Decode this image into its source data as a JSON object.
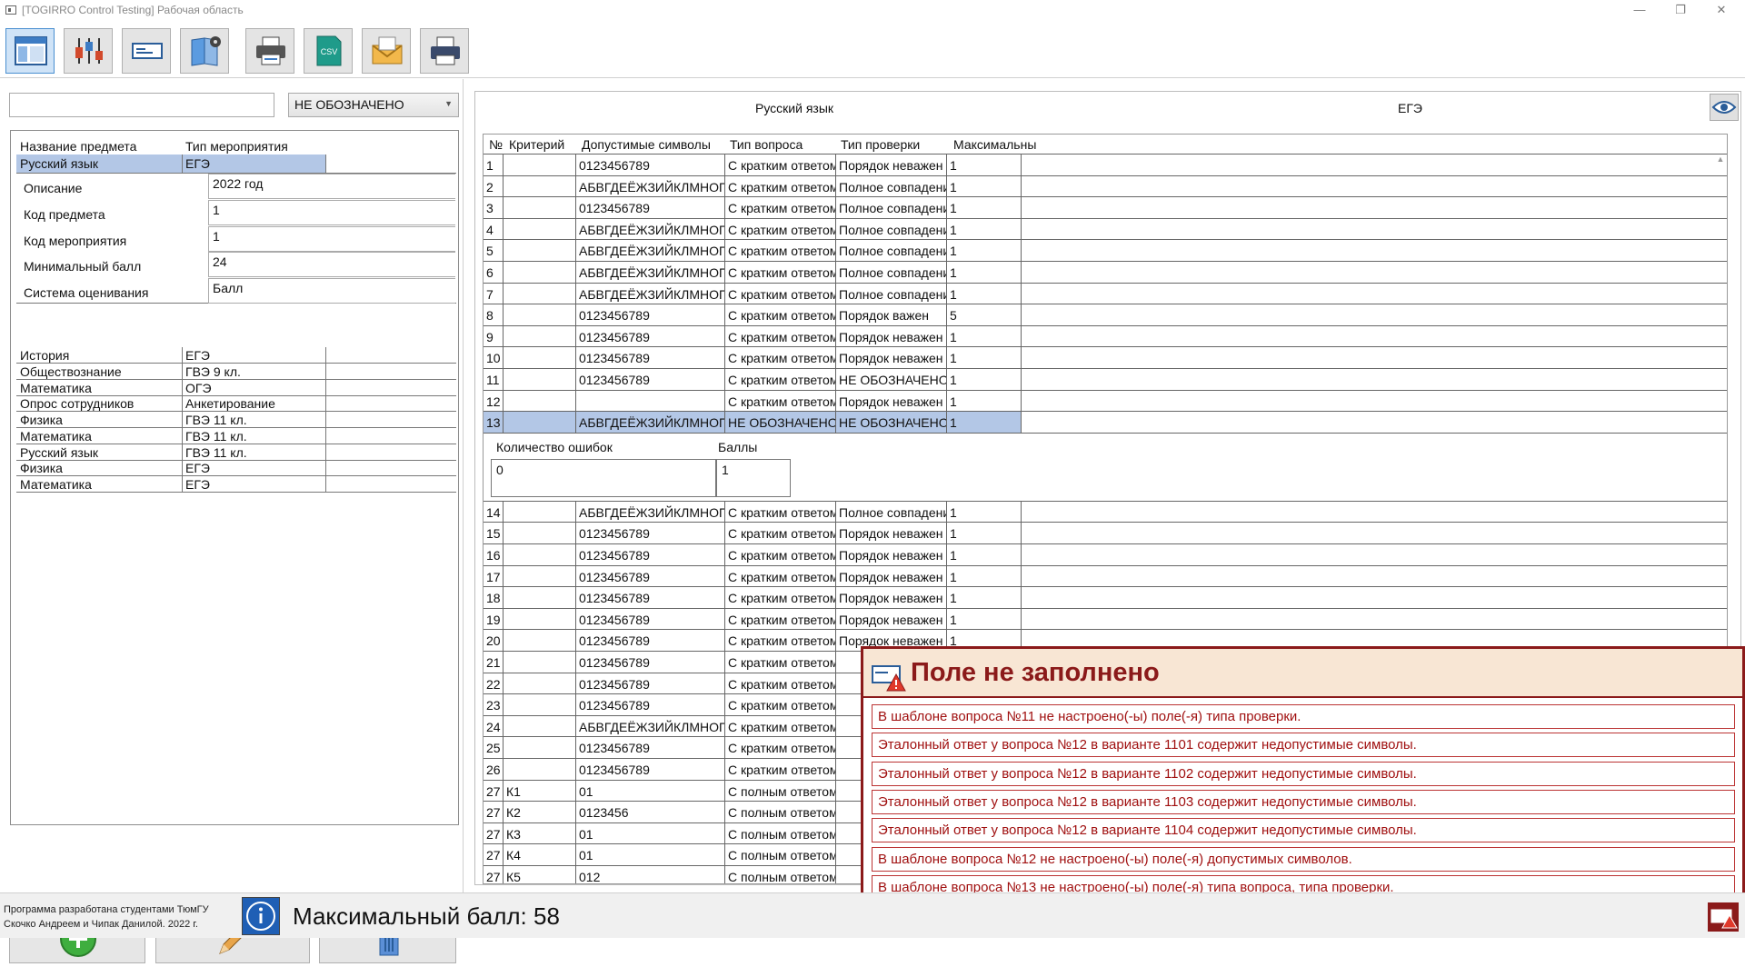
{
  "window": {
    "title": "[TOGIRRO Control Testing] Рабочая область",
    "controls": [
      "—",
      "❐",
      "✕"
    ]
  },
  "toolbar": {
    "buttons": [
      "layout-icon",
      "chart-icon",
      "form-icon",
      "book-settings-icon",
      "print-icon",
      "csv-icon",
      "mail-icon",
      "printer-icon"
    ],
    "csv_label": "CSV"
  },
  "left": {
    "search_value": "",
    "filter_value": "НЕ ОБОЗНАЧЕНО",
    "columns": [
      "Название предмета",
      "Тип мероприятия"
    ],
    "selected": {
      "subject": "Русский язык",
      "event": "ЕГЭ"
    },
    "details": [
      {
        "label": "Описание",
        "value": "2022 год"
      },
      {
        "label": "Код предмета",
        "value": "1"
      },
      {
        "label": "Код мероприятия",
        "value": "1"
      },
      {
        "label": "Минимальный балл",
        "value": "24"
      },
      {
        "label": "Система оценивания",
        "value": "Балл"
      }
    ],
    "rows": [
      {
        "subject": "История",
        "event": "ЕГЭ"
      },
      {
        "subject": "Обществознание",
        "event": "ГВЭ 9 кл."
      },
      {
        "subject": "Математика",
        "event": "ОГЭ"
      },
      {
        "subject": "Опрос сотрудников",
        "event": "Анкетирование"
      },
      {
        "subject": "Физика",
        "event": "ГВЭ 11 кл."
      },
      {
        "subject": "Математика",
        "event": "ГВЭ 11 кл."
      },
      {
        "subject": "Русский язык",
        "event": "ГВЭ 11 кл."
      },
      {
        "subject": "Физика",
        "event": "ЕГЭ"
      },
      {
        "subject": "Математика",
        "event": "ЕГЭ"
      }
    ]
  },
  "right": {
    "subject": "Русский язык",
    "event": "ЕГЭ",
    "columns": [
      "№",
      "Критерий",
      "Допустимые символы",
      "Тип вопроса",
      "Тип проверки",
      "Максимальны"
    ],
    "rows_top": [
      [
        "1",
        "",
        "0123456789",
        "С кратким ответом",
        "Порядок неважен",
        "1"
      ],
      [
        "2",
        "",
        "АБВГДЕЁЖЗИЙКЛМНОПРСТУФ",
        "С кратким ответом",
        "Полное совпадение",
        "1"
      ],
      [
        "3",
        "",
        "0123456789",
        "С кратким ответом",
        "Полное совпадение",
        "1"
      ],
      [
        "4",
        "",
        "АБВГДЕЁЖЗИЙКЛМНОПРСТУФ",
        "С кратким ответом",
        "Полное совпадение",
        "1"
      ],
      [
        "5",
        "",
        "АБВГДЕЁЖЗИЙКЛМНОПРСТУФ",
        "С кратким ответом",
        "Полное совпадение",
        "1"
      ],
      [
        "6",
        "",
        "АБВГДЕЁЖЗИЙКЛМНОПРСТУФ",
        "С кратким ответом",
        "Полное совпадение",
        "1"
      ],
      [
        "7",
        "",
        "АБВГДЕЁЖЗИЙКЛМНОПРСТУФ",
        "С кратким ответом",
        "Полное совпадение",
        "1"
      ],
      [
        "8",
        "",
        "0123456789",
        "С кратким ответом",
        "Порядок важен",
        "5"
      ],
      [
        "9",
        "",
        "0123456789",
        "С кратким ответом",
        "Порядок неважен",
        "1"
      ],
      [
        "10",
        "",
        "0123456789",
        "С кратким ответом",
        "Порядок неважен",
        "1"
      ],
      [
        "11",
        "",
        "0123456789",
        "С кратким ответом",
        "НЕ ОБОЗНАЧЕНО",
        "1"
      ],
      [
        "12",
        "",
        "",
        "С кратким ответом",
        "Порядок неважен",
        "1"
      ],
      [
        "13",
        "",
        "АБВГДЕЁЖЗИЙКЛМНОПРСТУФ",
        "НЕ ОБОЗНАЧЕНО",
        "НЕ ОБОЗНАЧЕНО",
        "1"
      ]
    ],
    "sub_detail": {
      "h1": "Количество ошибок",
      "h2": "Баллы",
      "v1": "0",
      "v2": "1"
    },
    "rows_bottom": [
      [
        "14",
        "",
        "АБВГДЕЁЖЗИЙКЛМНОПРСТУФ",
        "С кратким ответом",
        "Полное совпадение",
        "1"
      ],
      [
        "15",
        "",
        "0123456789",
        "С кратким ответом",
        "Порядок неважен",
        "1"
      ],
      [
        "16",
        "",
        "0123456789",
        "С кратким ответом",
        "Порядок неважен",
        "1"
      ],
      [
        "17",
        "",
        "0123456789",
        "С кратким ответом",
        "Порядок неважен",
        "1"
      ],
      [
        "18",
        "",
        "0123456789",
        "С кратким ответом",
        "Порядок неважен",
        "1"
      ],
      [
        "19",
        "",
        "0123456789",
        "С кратким ответом",
        "Порядок неважен",
        "1"
      ],
      [
        "20",
        "",
        "0123456789",
        "С кратким ответом",
        "Порядок неважен",
        "1"
      ],
      [
        "21",
        "",
        "0123456789",
        "С кратким ответом",
        "",
        ""
      ],
      [
        "22",
        "",
        "0123456789",
        "С кратким ответом",
        "",
        ""
      ],
      [
        "23",
        "",
        "0123456789",
        "С кратким ответом",
        "",
        ""
      ],
      [
        "24",
        "",
        "АБВГДЕЁЖЗИЙКЛМНОПРСТУФ",
        "С кратким ответом",
        "",
        ""
      ],
      [
        "25",
        "",
        "0123456789",
        "С кратким ответом",
        "",
        ""
      ],
      [
        "26",
        "",
        "0123456789",
        "С кратким ответом",
        "",
        ""
      ],
      [
        "27",
        "К1",
        "01",
        "С полным ответом",
        "",
        ""
      ],
      [
        "27",
        "К2",
        "0123456",
        "С полным ответом",
        "",
        ""
      ],
      [
        "27",
        "К3",
        "01",
        "С полным ответом",
        "",
        ""
      ],
      [
        "27",
        "К4",
        "01",
        "С полным ответом",
        "",
        ""
      ],
      [
        "27",
        "К5",
        "012",
        "С полным ответом",
        "",
        ""
      ]
    ]
  },
  "popup": {
    "title": "Поле не заполнено",
    "messages": [
      "В шаблоне вопроса №11 не настроено(-ы) поле(-я) типа проверки.",
      "Эталонный ответ у вопроса №12 в варианте 1101 содержит недопустимые символы.",
      "Эталонный ответ у вопроса №12 в варианте 1102 содержит недопустимые символы.",
      "Эталонный ответ у вопроса №12 в варианте 1103 содержит недопустимые символы.",
      "Эталонный ответ у вопроса №12 в варианте 1104 содержит недопустимые символы.",
      "В шаблоне вопроса №12 не настроено(-ы) поле(-я) допустимых символов.",
      "В шаблоне вопроса №13 не настроено(-ы) поле(-я) типа вопроса, типа проверки."
    ]
  },
  "status": {
    "credits_line1": "Программа разработана студентами ТюмГУ",
    "credits_line2": "Скочко Андреем и Чипак Данилой. 2022 г.",
    "max_label": "Максимальный балл:",
    "max_value": "58"
  },
  "colors": {
    "accent": "#8b1a1a",
    "selection": "#b3c7e6",
    "popup_bg": "#f8e6d4"
  }
}
